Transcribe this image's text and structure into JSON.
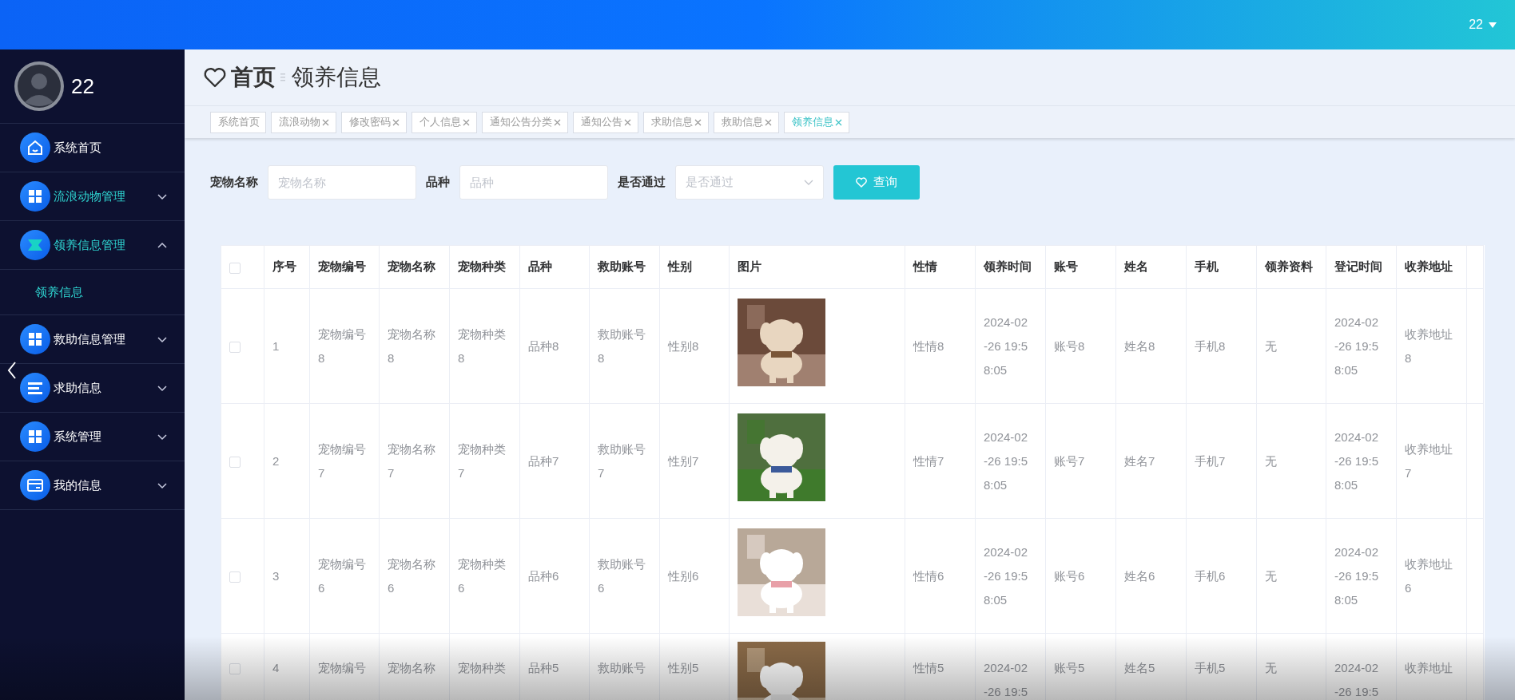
{
  "top_bar": {
    "user": "22"
  },
  "sidebar": {
    "user_name": "22",
    "items": [
      {
        "label": "系统首页",
        "kind": "link",
        "highlighted": false
      },
      {
        "label": "流浪动物管理",
        "kind": "group",
        "highlighted": true,
        "expanded": false
      },
      {
        "label": "领养信息管理",
        "kind": "group",
        "highlighted": true,
        "expanded": true,
        "children": [
          {
            "label": "领养信息",
            "highlighted": true
          }
        ]
      },
      {
        "label": "救助信息管理",
        "kind": "group",
        "highlighted": false,
        "expanded": false
      },
      {
        "label": "求助信息",
        "kind": "group",
        "highlighted": false,
        "expanded": false
      },
      {
        "label": "系统管理",
        "kind": "group",
        "highlighted": false,
        "expanded": false
      },
      {
        "label": "我的信息",
        "kind": "group",
        "highlighted": false,
        "expanded": false
      }
    ]
  },
  "breadcrumb": {
    "home": "首页",
    "current": "领养信息"
  },
  "tags": [
    {
      "label": "系统首页",
      "closable": false,
      "selected": false
    },
    {
      "label": "流浪动物",
      "closable": true,
      "selected": false
    },
    {
      "label": "修改密码",
      "closable": true,
      "selected": false
    },
    {
      "label": "个人信息",
      "closable": true,
      "selected": false
    },
    {
      "label": "通知公告分类",
      "closable": true,
      "selected": false
    },
    {
      "label": "通知公告",
      "closable": true,
      "selected": false
    },
    {
      "label": "求助信息",
      "closable": true,
      "selected": false
    },
    {
      "label": "救助信息",
      "closable": true,
      "selected": false
    },
    {
      "label": "领养信息",
      "closable": true,
      "selected": true
    }
  ],
  "search": {
    "fields": [
      {
        "label": "宠物名称",
        "placeholder": "宠物名称",
        "kind": "text"
      },
      {
        "label": "品种",
        "placeholder": "品种",
        "kind": "text"
      },
      {
        "label": "是否通过",
        "placeholder": "是否通过",
        "kind": "select"
      }
    ],
    "button": "查询"
  },
  "table": {
    "header_checked": false,
    "columns": [
      {
        "label": "序号",
        "kind": "text"
      },
      {
        "label": "宠物编号",
        "kind": "text"
      },
      {
        "label": "宠物名称",
        "kind": "text"
      },
      {
        "label": "宠物种类",
        "kind": "text"
      },
      {
        "label": "品种",
        "kind": "text"
      },
      {
        "label": "救助账号",
        "kind": "text"
      },
      {
        "label": "性别",
        "kind": "text"
      },
      {
        "label": "图片",
        "kind": "picture"
      },
      {
        "label": "性情",
        "kind": "text"
      },
      {
        "label": "领养时间",
        "kind": "time"
      },
      {
        "label": "账号",
        "kind": "text"
      },
      {
        "label": "姓名",
        "kind": "text"
      },
      {
        "label": "手机",
        "kind": "text"
      },
      {
        "label": "领养资料",
        "kind": "text"
      },
      {
        "label": "登记时间",
        "kind": "time"
      },
      {
        "label": "收养地址",
        "kind": "text"
      }
    ],
    "rows": [
      {
        "checked": false,
        "cells": [
          "1",
          "宠物编号8",
          "宠物名称8",
          "宠物种类8",
          "品种8",
          "救助账号8",
          "性别8",
          {
            "kind": "picture"
          },
          "性情8",
          "2024-02-26 19:58:05",
          "账号8",
          "姓名8",
          "手机8",
          "无",
          "2024-02-26 19:58:05",
          "收养地址8"
        ]
      },
      {
        "checked": false,
        "cells": [
          "2",
          "宠物编号7",
          "宠物名称7",
          "宠物种类7",
          "品种7",
          "救助账号7",
          "性别7",
          {
            "kind": "picture"
          },
          "性情7",
          "2024-02-26 19:58:05",
          "账号7",
          "姓名7",
          "手机7",
          "无",
          "2024-02-26 19:58:05",
          "收养地址7"
        ]
      },
      {
        "checked": false,
        "cells": [
          "3",
          "宠物编号6",
          "宠物名称6",
          "宠物种类6",
          "品种6",
          "救助账号6",
          "性别6",
          {
            "kind": "picture"
          },
          "性情6",
          "2024-02-26 19:58:05",
          "账号6",
          "姓名6",
          "手机6",
          "无",
          "2024-02-26 19:58:05",
          "收养地址6"
        ]
      },
      {
        "checked": false,
        "cells": [
          "4",
          "宠物编号",
          "宠物名称",
          "宠物种类",
          "品种5",
          "救助账号",
          "性别5",
          {
            "kind": "picture"
          },
          "性情5",
          "2024-02-26 19:5",
          "账号5",
          "姓名5",
          "手机5",
          "无",
          "2024-02-26 19:5",
          "收养地址"
        ]
      }
    ]
  }
}
